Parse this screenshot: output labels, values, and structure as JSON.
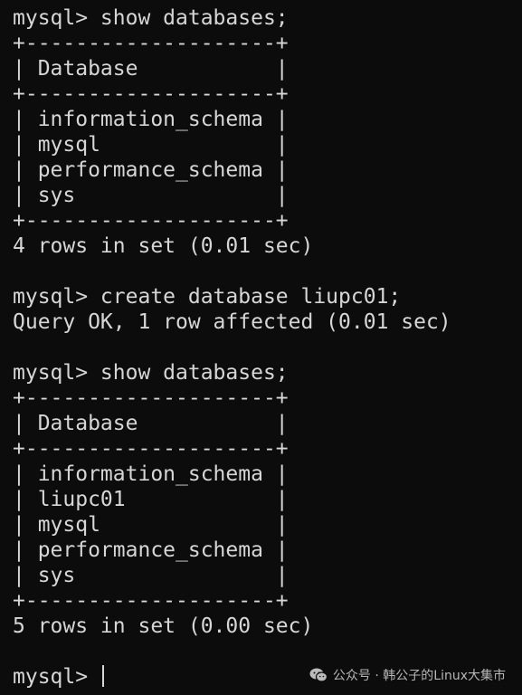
{
  "terminal": {
    "lines": [
      "mysql> show databases;",
      "+--------------------+",
      "| Database           |",
      "+--------------------+",
      "| information_schema |",
      "| mysql              |",
      "| performance_schema |",
      "| sys                |",
      "+--------------------+",
      "4 rows in set (0.01 sec)",
      "",
      "mysql> create database liupc01;",
      "Query OK, 1 row affected (0.01 sec)",
      "",
      "mysql> show databases;",
      "+--------------------+",
      "| Database           |",
      "+--------------------+",
      "| information_schema |",
      "| liupc01            |",
      "| mysql              |",
      "| performance_schema |",
      "| sys                |",
      "+--------------------+",
      "5 rows in set (0.00 sec)",
      ""
    ],
    "prompt": "mysql> "
  },
  "watermark": {
    "text": "公众号 · 韩公子的Linux大集市",
    "icon": "wechat-icon"
  }
}
